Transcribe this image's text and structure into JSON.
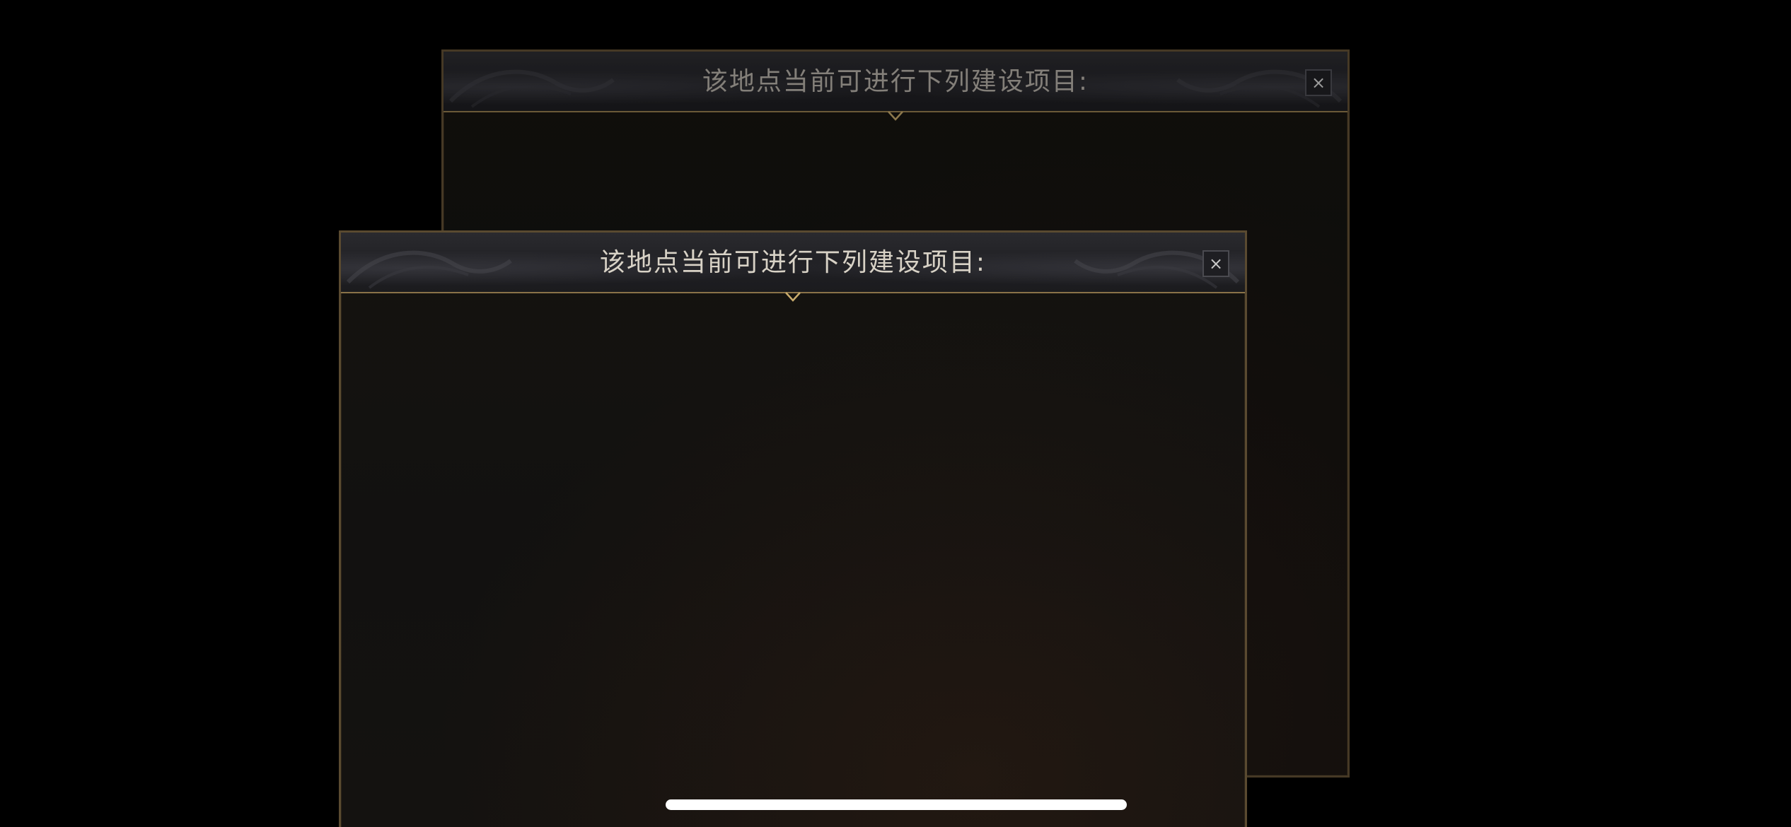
{
  "dialogs": {
    "back": {
      "title": "该地点当前可进行下列建设项目:",
      "close_symbol": "×"
    },
    "front": {
      "title": "该地点当前可进行下列建设项目:",
      "close_symbol": "×"
    }
  },
  "colors": {
    "frame_gold": "#8a7348",
    "panel_bg": "#131210",
    "header_bg": "#1f1f23",
    "title_text": "#d8d2c6"
  },
  "icons": {
    "close": "close-icon",
    "notch": "chevron-down-icon",
    "ornament": "ornament-swirl"
  }
}
